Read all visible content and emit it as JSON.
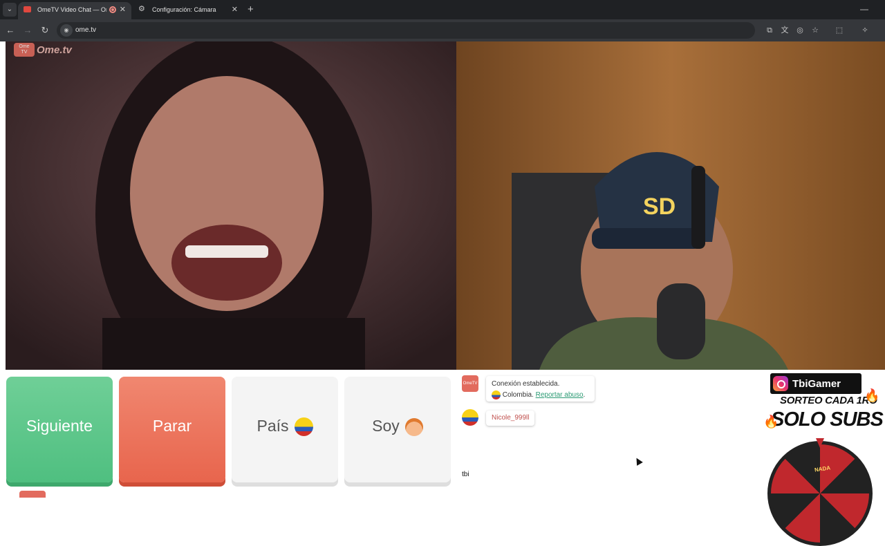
{
  "browser": {
    "tabs": [
      {
        "title": "OmeTV Video Chat — Ome",
        "active": true
      },
      {
        "title": "Configuración: Cámara",
        "active": false
      }
    ],
    "url": "ome.tv"
  },
  "site": {
    "logo_text": "Ome.tv",
    "buttons": {
      "next": "Siguiente",
      "stop": "Parar",
      "country": "País",
      "gender": "Soy"
    }
  },
  "chat": {
    "system_message": {
      "line1": "Conexión establecida.",
      "country": "Colombia.",
      "report_link": "Reportar abuso"
    },
    "user_message": {
      "username": "Nicole_999ll"
    },
    "input_value": "tbi"
  },
  "overlay": {
    "instagram_handle": "TbiGamer",
    "promo_line1": "SORTEO CADA 1RO",
    "promo_line2": "SOLO SUBS",
    "wheel_label": "NADA"
  },
  "colors": {
    "next_button": "#5cc68b",
    "stop_button": "#ea6f56",
    "neutral_button": "#f4f4f4",
    "report_link": "#2a9a73",
    "username": "#c0504d"
  }
}
